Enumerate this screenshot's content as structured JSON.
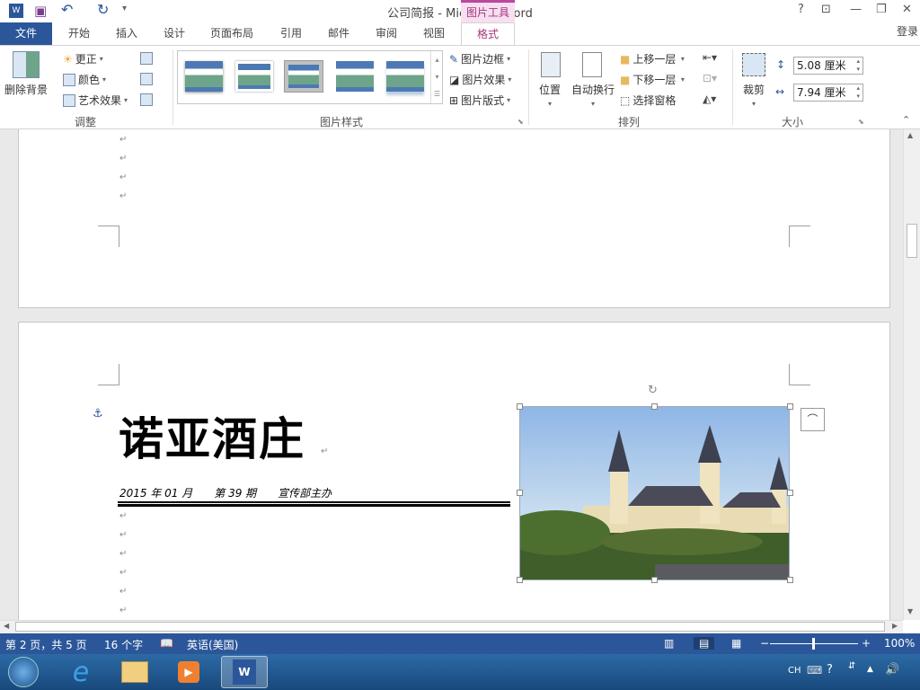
{
  "window": {
    "title": "公司简报 - Microsoft Word",
    "context_tab": "图片工具",
    "help": "?",
    "login": "登录"
  },
  "tabs": [
    "文件",
    "开始",
    "插入",
    "设计",
    "页面布局",
    "引用",
    "邮件",
    "审阅",
    "视图",
    "格式"
  ],
  "ribbon": {
    "adjust": {
      "label": "调整",
      "remove_bg": "删除背景",
      "corrections": "更正",
      "color": "颜色",
      "artistic": "艺术效果"
    },
    "styles": {
      "label": "图片样式",
      "border": "图片边框",
      "effects": "图片效果",
      "layout": "图片版式"
    },
    "arrange": {
      "label": "排列",
      "position": "位置",
      "wrap": "自动换行",
      "forward": "上移一层",
      "backward": "下移一层",
      "pane": "选择窗格"
    },
    "size": {
      "label": "大小",
      "crop": "裁剪",
      "height": "5.08 厘米",
      "width": "7.94 厘米"
    }
  },
  "document": {
    "title": "诺亚酒庄",
    "subtitle": "2015 年 01 月　　第 39 期　　宣传部主办",
    "para_mark": "↵"
  },
  "status": {
    "page": "第 2 页，共 5 页",
    "words": "16 个字",
    "language": "英语(美国)",
    "zoom": "100%"
  },
  "taskbar": {
    "lang": "CH"
  }
}
